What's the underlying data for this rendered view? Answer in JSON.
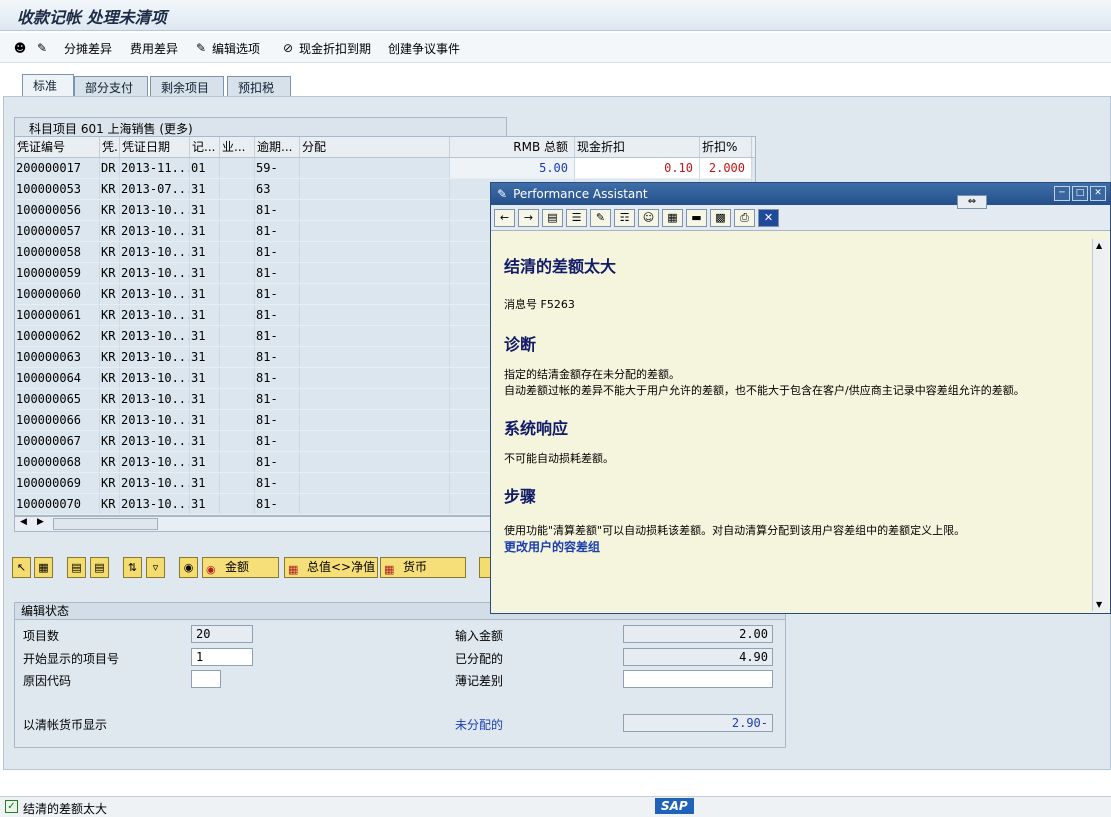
{
  "window": {
    "title": "收款记帐 处理未清项"
  },
  "toolbar": {
    "b1": "分摊差异",
    "b2": "费用差异",
    "b3": "编辑选项",
    "b4": "现金折扣到期",
    "b5": "创建争议事件"
  },
  "tabs": [
    "标准",
    "部分支付",
    "剩余项目",
    "预扣税"
  ],
  "grid": {
    "title": "科目项目 601 上海销售 (更多)",
    "headers": [
      "凭证编号",
      "凭.",
      "凭证日期",
      "记...",
      "业...",
      "逾期...",
      "分配",
      "RMB 总额",
      "现金折扣",
      "折扣%"
    ],
    "rows": [
      [
        "200000017",
        "DR",
        "2013-11...",
        "01",
        "",
        "59-",
        "",
        "5.00",
        "0.10",
        "2.000"
      ],
      [
        "100000053",
        "KR",
        "2013-07...",
        "31",
        "",
        "63",
        "",
        "",
        "",
        ""
      ],
      [
        "100000056",
        "KR",
        "2013-10...",
        "31",
        "",
        "81-",
        "",
        "",
        "",
        ""
      ],
      [
        "100000057",
        "KR",
        "2013-10...",
        "31",
        "",
        "81-",
        "",
        "",
        "",
        ""
      ],
      [
        "100000058",
        "KR",
        "2013-10...",
        "31",
        "",
        "81-",
        "",
        "",
        "",
        ""
      ],
      [
        "100000059",
        "KR",
        "2013-10...",
        "31",
        "",
        "81-",
        "",
        "",
        "",
        ""
      ],
      [
        "100000060",
        "KR",
        "2013-10...",
        "31",
        "",
        "81-",
        "",
        "",
        "",
        ""
      ],
      [
        "100000061",
        "KR",
        "2013-10...",
        "31",
        "",
        "81-",
        "",
        "",
        "",
        ""
      ],
      [
        "100000062",
        "KR",
        "2013-10...",
        "31",
        "",
        "81-",
        "",
        "",
        "",
        ""
      ],
      [
        "100000063",
        "KR",
        "2013-10...",
        "31",
        "",
        "81-",
        "",
        "",
        "",
        ""
      ],
      [
        "100000064",
        "KR",
        "2013-10...",
        "31",
        "",
        "81-",
        "",
        "",
        "",
        ""
      ],
      [
        "100000065",
        "KR",
        "2013-10...",
        "31",
        "",
        "81-",
        "",
        "",
        "",
        ""
      ],
      [
        "100000066",
        "KR",
        "2013-10...",
        "31",
        "",
        "81-",
        "",
        "",
        "",
        ""
      ],
      [
        "100000067",
        "KR",
        "2013-10...",
        "31",
        "",
        "81-",
        "",
        "",
        "",
        ""
      ],
      [
        "100000068",
        "KR",
        "2013-10...",
        "31",
        "",
        "81-",
        "",
        "",
        "",
        ""
      ],
      [
        "100000069",
        "KR",
        "2013-10...",
        "31",
        "",
        "81-",
        "",
        "",
        "",
        ""
      ],
      [
        "100000070",
        "KR",
        "2013-10...",
        "31",
        "",
        "81-",
        "",
        "",
        "",
        ""
      ]
    ]
  },
  "buttons": {
    "amount": "金额",
    "gross_net": "总值<>净值",
    "currency": "货币"
  },
  "edit": {
    "header": "编辑状态",
    "items_label": "项目数",
    "items_value": "20",
    "start_label": "开始显示的项目号",
    "start_value": "1",
    "reason_label": "原因代码",
    "reason_value": "",
    "currency_label": "以清帐货币显示",
    "input_label": "输入金额",
    "input_value": "2.00",
    "assigned_label": "已分配的",
    "assigned_value": "4.90",
    "diff_label": "薄记差别",
    "diff_value": "",
    "unassigned_label": "未分配的",
    "unassigned_value": "2.90-"
  },
  "pa": {
    "title": "Performance Assistant",
    "h1": "结清的差额太大",
    "msg": "消息号 F5263",
    "h2": "诊断",
    "diag1": "指定的结清金额存在未分配的差额。",
    "diag2": "自动差额过帐的差异不能大于用户允许的差额，也不能大于包含在客户/供应商主记录中容差组允许的差额。",
    "h3": "系统响应",
    "resp": "不可能自动损耗差额。",
    "h4": "步骤",
    "step": "使用功能\"清算差额\"可以自动损耗该差额。对自动清算分配到该用户容差组中的差额定义上限。",
    "link": "更改用户的容差组"
  },
  "status": {
    "message": "结清的差额太大",
    "logo": "SAP"
  }
}
